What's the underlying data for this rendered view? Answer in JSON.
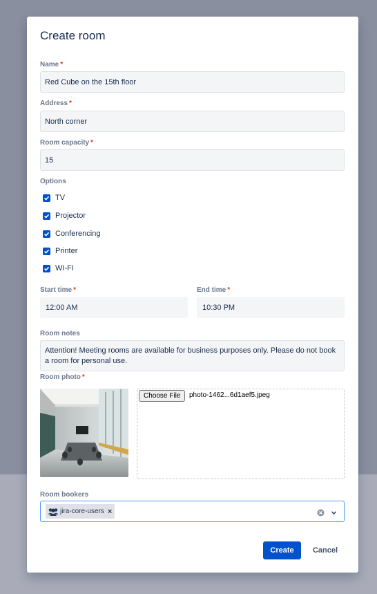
{
  "modal": {
    "title": "Create room"
  },
  "form": {
    "name": {
      "label": "Name",
      "required_mark": "*",
      "value": "Red Cube on the 15th floor"
    },
    "address": {
      "label": "Address",
      "required_mark": "*",
      "value": "North corner"
    },
    "capacity": {
      "label": "Room capacity",
      "required_mark": "*",
      "value": "15"
    },
    "options": {
      "label": "Options",
      "items": [
        {
          "label": "TV",
          "checked": true
        },
        {
          "label": "Projector",
          "checked": true
        },
        {
          "label": "Conferencing",
          "checked": true
        },
        {
          "label": "Printer",
          "checked": true
        },
        {
          "label": "WI-FI",
          "checked": true
        }
      ]
    },
    "start_time": {
      "label": "Start time",
      "required_mark": "*",
      "value": "12:00 AM"
    },
    "end_time": {
      "label": "End time",
      "required_mark": "*",
      "value": "10:30 PM"
    },
    "notes": {
      "label": "Room notes",
      "value": "Attention! Meeting rooms are available for business purposes only. Please do not book a room for personal use."
    },
    "photo": {
      "label": "Room photo",
      "required_mark": "*",
      "choose_file_label": "Choose File",
      "file_name": "photo-1462...6d1aef5.jpeg"
    },
    "bookers": {
      "label": "Room bookers",
      "tags": [
        {
          "label": "jira-core-users",
          "icon": "group-icon"
        }
      ],
      "remove_glyph": "×"
    }
  },
  "actions": {
    "create_label": "Create",
    "cancel_label": "Cancel"
  },
  "colors": {
    "primary": "#0052cc",
    "required": "#de350b",
    "focus_border": "#4c9aff",
    "backdrop": "#8a8f9f"
  }
}
